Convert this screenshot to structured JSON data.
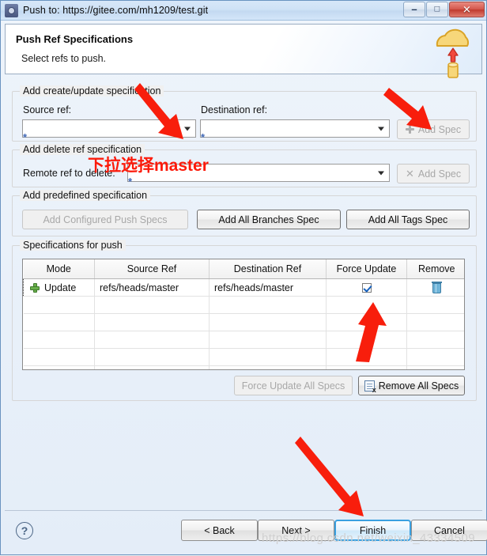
{
  "window": {
    "title": "Push to: https://gitee.com/mh1209/test.git",
    "icon": "app-gear-icon",
    "controls": {
      "minimize": "–",
      "restore": "□",
      "close": "✕"
    }
  },
  "header": {
    "title": "Push Ref Specifications",
    "subtitle": "Select refs to push.",
    "icon": "cloud-push-icon"
  },
  "create_update_group": {
    "legend": "Add create/update specification",
    "source_label": "Source ref:",
    "source_value": "",
    "destination_label": "Destination ref:",
    "destination_value": "",
    "required_marker": "*",
    "add_spec_label": "Add Spec",
    "add_spec_icon": "plus-icon",
    "add_spec_disabled": true
  },
  "delete_group": {
    "legend": "Add delete ref specification",
    "remote_label": "Remote ref to delete:",
    "remote_value": "",
    "required_marker": "*",
    "add_spec_label": "Add Spec",
    "add_spec_icon": "x-icon",
    "add_spec_disabled": true
  },
  "predefined_group": {
    "legend": "Add predefined specification",
    "buttons": [
      {
        "label": "Add Configured Push Specs",
        "disabled": true
      },
      {
        "label": "Add All Branches Spec",
        "disabled": false
      },
      {
        "label": "Add All Tags Spec",
        "disabled": false
      }
    ]
  },
  "specs_group": {
    "legend": "Specifications for push",
    "columns": [
      "Mode",
      "Source Ref",
      "Destination Ref",
      "Force Update",
      "Remove"
    ],
    "rows": [
      {
        "mode": "Update",
        "mode_icon": "green-plus-icon",
        "source_ref": "refs/heads/master",
        "destination_ref": "refs/heads/master",
        "force_update": true,
        "remove_icon": "trash-icon"
      }
    ],
    "empty_row_count": 7,
    "force_update_all_label": "Force Update All Specs",
    "force_update_all_disabled": true,
    "remove_all_label": "Remove All Specs",
    "remove_all_icon": "document-delete-icon"
  },
  "bottom": {
    "help_icon": "question-mark-icon",
    "buttons": [
      {
        "name": "back",
        "label": "< Back"
      },
      {
        "name": "next",
        "label": "Next >"
      },
      {
        "name": "finish",
        "label": "Finish"
      },
      {
        "name": "cancel",
        "label": "Cancel"
      }
    ]
  },
  "annotations": {
    "red_text": "下拉选择master",
    "arrow_color": "#f81e0c",
    "arrow_count": 4
  },
  "watermark": "https://blog.csdn.net/weixin_43334509"
}
